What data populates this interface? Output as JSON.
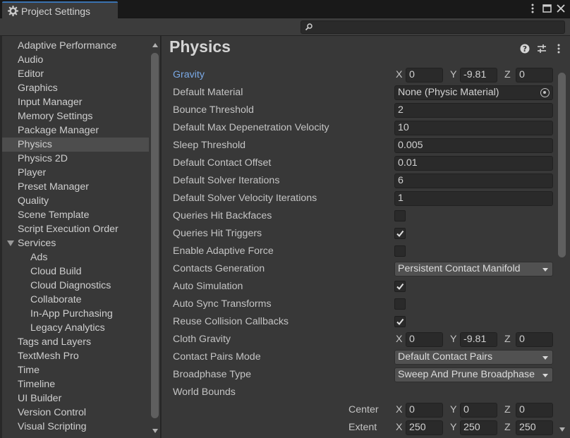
{
  "window": {
    "tab_title": "Project Settings",
    "tab_icon": "gear-icon",
    "controls": [
      "kebab-menu-icon",
      "maximize-icon",
      "close-icon"
    ]
  },
  "search": {
    "placeholder": "",
    "value": ""
  },
  "sidebar": {
    "selected": "Physics",
    "items": [
      {
        "label": "Adaptive Performance",
        "indent": 0
      },
      {
        "label": "Audio",
        "indent": 0
      },
      {
        "label": "Editor",
        "indent": 0
      },
      {
        "label": "Graphics",
        "indent": 0
      },
      {
        "label": "Input Manager",
        "indent": 0
      },
      {
        "label": "Memory Settings",
        "indent": 0
      },
      {
        "label": "Package Manager",
        "indent": 0
      },
      {
        "label": "Physics",
        "indent": 0,
        "selected": true
      },
      {
        "label": "Physics 2D",
        "indent": 0
      },
      {
        "label": "Player",
        "indent": 0
      },
      {
        "label": "Preset Manager",
        "indent": 0
      },
      {
        "label": "Quality",
        "indent": 0
      },
      {
        "label": "Scene Template",
        "indent": 0
      },
      {
        "label": "Script Execution Order",
        "indent": 0
      },
      {
        "label": "Services",
        "indent": 0,
        "expanded": true
      },
      {
        "label": "Ads",
        "indent": 1
      },
      {
        "label": "Cloud Build",
        "indent": 1
      },
      {
        "label": "Cloud Diagnostics",
        "indent": 1
      },
      {
        "label": "Collaborate",
        "indent": 1
      },
      {
        "label": "In-App Purchasing",
        "indent": 1
      },
      {
        "label": "Legacy Analytics",
        "indent": 1
      },
      {
        "label": "Tags and Layers",
        "indent": 0
      },
      {
        "label": "TextMesh Pro",
        "indent": 0
      },
      {
        "label": "Time",
        "indent": 0
      },
      {
        "label": "Timeline",
        "indent": 0
      },
      {
        "label": "UI Builder",
        "indent": 0
      },
      {
        "label": "Version Control",
        "indent": 0
      },
      {
        "label": "Visual Scripting",
        "indent": 0
      }
    ]
  },
  "main": {
    "title": "Physics",
    "header_icons": [
      "help-icon",
      "preset-icon",
      "kebab-menu-icon"
    ],
    "gravity": {
      "label": "Gravity",
      "x": "0",
      "y": "-9.81",
      "z": "0"
    },
    "default_material": {
      "label": "Default Material",
      "value": "None (Physic Material)"
    },
    "bounce_threshold": {
      "label": "Bounce Threshold",
      "value": "2"
    },
    "max_depenetration": {
      "label": "Default Max Depenetration Velocity",
      "value": "10"
    },
    "sleep_threshold": {
      "label": "Sleep Threshold",
      "value": "0.005"
    },
    "contact_offset": {
      "label": "Default Contact Offset",
      "value": "0.01"
    },
    "solver_iterations": {
      "label": "Default Solver Iterations",
      "value": "6"
    },
    "solver_velocity_iterations": {
      "label": "Default Solver Velocity Iterations",
      "value": "1"
    },
    "queries_hit_backfaces": {
      "label": "Queries Hit Backfaces",
      "checked": false
    },
    "queries_hit_triggers": {
      "label": "Queries Hit Triggers",
      "checked": true
    },
    "enable_adaptive_force": {
      "label": "Enable Adaptive Force",
      "checked": false
    },
    "contacts_generation": {
      "label": "Contacts Generation",
      "value": "Persistent Contact Manifold"
    },
    "auto_simulation": {
      "label": "Auto Simulation",
      "checked": true
    },
    "auto_sync_transforms": {
      "label": "Auto Sync Transforms",
      "checked": false
    },
    "reuse_collision_callbacks": {
      "label": "Reuse Collision Callbacks",
      "checked": true
    },
    "cloth_gravity": {
      "label": "Cloth Gravity",
      "x": "0",
      "y": "-9.81",
      "z": "0"
    },
    "contact_pairs_mode": {
      "label": "Contact Pairs Mode",
      "value": "Default Contact Pairs"
    },
    "broadphase_type": {
      "label": "Broadphase Type",
      "value": "Sweep And Prune Broadphase"
    },
    "world_bounds": {
      "label": "World Bounds",
      "center": {
        "label": "Center",
        "x": "0",
        "y": "0",
        "z": "0"
      },
      "extent": {
        "label": "Extent",
        "x": "250",
        "y": "250",
        "z": "250"
      }
    },
    "axis_labels": {
      "x": "X",
      "y": "Y",
      "z": "Z"
    }
  }
}
